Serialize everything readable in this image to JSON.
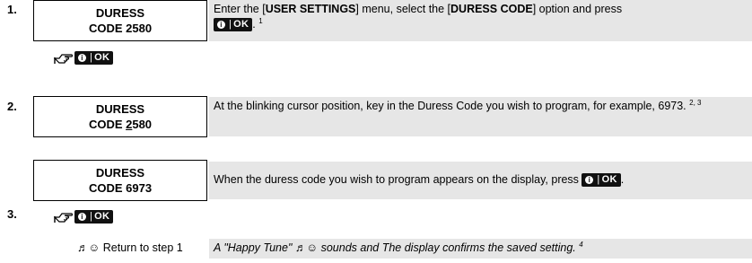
{
  "steps": {
    "n1": "1.",
    "n2": "2.",
    "n3": "3."
  },
  "lcd1": {
    "line1": "DURESS",
    "line2": "CODE 2580"
  },
  "lcd2": {
    "line1": "DURESS",
    "line2_before": "CODE ",
    "line2_cursor": "2",
    "line2_after": "580"
  },
  "lcd3": {
    "line1": "DURESS",
    "line2": "CODE 6973"
  },
  "instr1": {
    "p1": "Enter the [",
    "b1": "USER SETTINGS",
    "p2": "] menu, select the [",
    "b2": "DURESS CODE",
    "p3": "] option and press",
    "after_key": ".",
    "fn": "1"
  },
  "instr2": {
    "text": "At the blinking cursor position, key in the Duress Code you wish to program, for example, 6973.",
    "fn": "2, 3"
  },
  "instr3": {
    "text": "When the duress code you wish to program appears on the display, press",
    "after_key": "."
  },
  "ok_key": {
    "info": "i",
    "sep": "|",
    "label": "OK"
  },
  "return_row": {
    "label": "Return to step 1",
    "text": "A \"Happy Tune\" ♬☺ sounds and The display confirms the saved setting.",
    "fn": "4"
  },
  "icons": {
    "note": "♬",
    "smiley": "☺"
  }
}
